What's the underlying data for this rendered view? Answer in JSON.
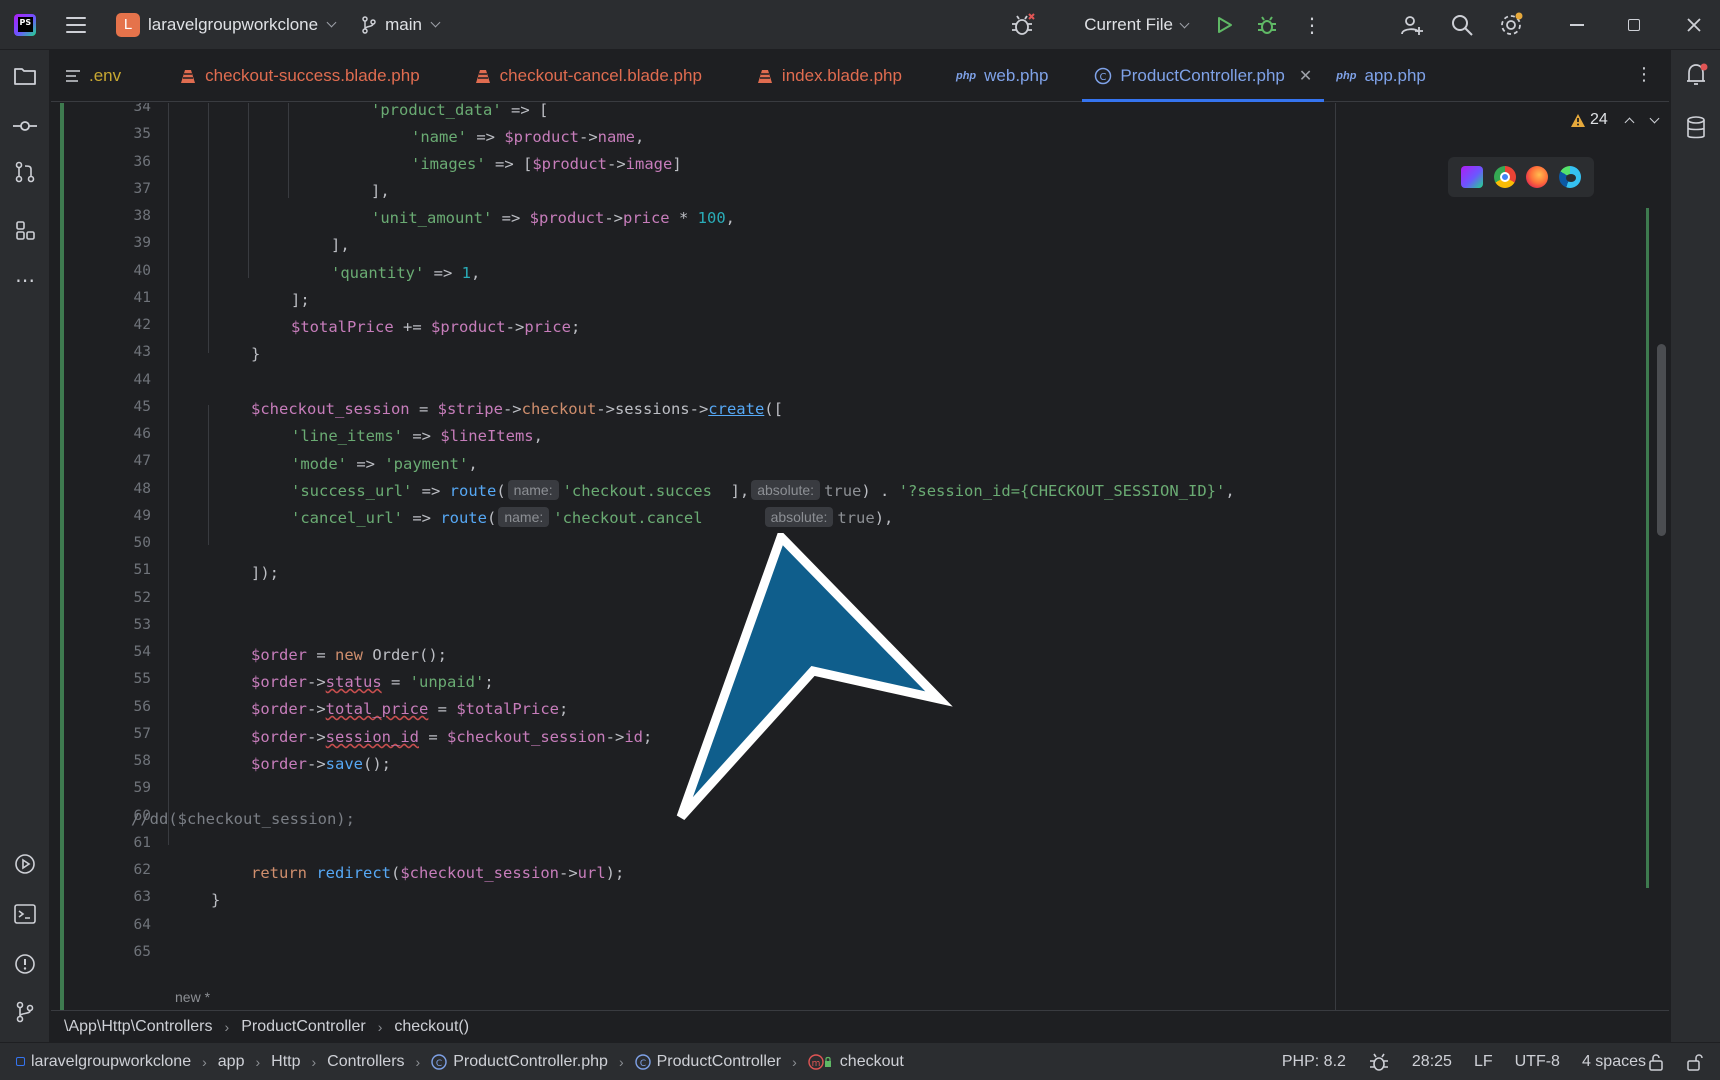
{
  "titlebar": {
    "project_badge": "L",
    "project_name": "laravelgroupworkclone",
    "branch": "main",
    "run_config": "Current File"
  },
  "tabs": [
    {
      "label": ".env",
      "kind": "env"
    },
    {
      "label": "checkout-success.blade.php",
      "kind": "blade"
    },
    {
      "label": "checkout-cancel.blade.php",
      "kind": "blade"
    },
    {
      "label": "index.blade.php",
      "kind": "blade"
    },
    {
      "label": "web.php",
      "kind": "php"
    },
    {
      "label": "ProductController.php",
      "kind": "class",
      "active": true
    },
    {
      "label": "app.php",
      "kind": "php"
    }
  ],
  "editor": {
    "warning_count": "24",
    "line_numbers": [
      "34",
      "35",
      "36",
      "37",
      "38",
      "39",
      "40",
      "41",
      "42",
      "43",
      "44",
      "45",
      "46",
      "47",
      "48",
      "49",
      "50",
      "51",
      "52",
      "53",
      "54",
      "55",
      "56",
      "57",
      "58",
      "59",
      "60",
      "61",
      "62",
      "63",
      "64",
      "65"
    ],
    "code": {
      "l34_a": "'product_data'",
      "l34_b": " => [",
      "l35_a": "'name'",
      "l35_b": " => ",
      "l35_c": "$product",
      "l35_d": "->",
      "l35_e": "name",
      "l35_f": ",",
      "l36_a": "'images'",
      "l36_b": " => [",
      "l36_c": "$product",
      "l36_d": "->",
      "l36_e": "image",
      "l36_f": "]",
      "l37": "],",
      "l38_a": "'unit_amount'",
      "l38_b": " => ",
      "l38_c": "$product",
      "l38_d": "->",
      "l38_e": "price",
      "l38_f": " * ",
      "l38_g": "100",
      "l38_h": ",",
      "l39": "],",
      "l40_a": "'quantity'",
      "l40_b": " => ",
      "l40_c": "1",
      "l40_d": ",",
      "l41": "];",
      "l42_a": "$totalPrice",
      "l42_b": " += ",
      "l42_c": "$product",
      "l42_d": "->",
      "l42_e": "price",
      "l42_f": ";",
      "l43": "}",
      "l45_a": "$checkout_session",
      "l45_b": " = ",
      "l45_c": "$stripe",
      "l45_d": "->",
      "l45_e": "checkout",
      "l45_f": "->",
      "l45_g": "sessions",
      "l45_h": "->",
      "l45_i": "create",
      "l45_j": "([",
      "l46_a": "'line_items'",
      "l46_b": " => ",
      "l46_c": "$lineItems",
      "l46_d": ",",
      "l47_a": "'mode'",
      "l47_b": " => ",
      "l47_c": "'payment'",
      "l47_d": ",",
      "l48_a": "'success_url'",
      "l48_b": " => ",
      "l48_c": "route",
      "l48_d": "(",
      "l48_hint1": "name:",
      "l48_e": "'checkout.succes",
      "l48_f": "  ],",
      "l48_hint2": "absolute:",
      "l48_g": "true",
      "l48_h": ") . ",
      "l48_i": "'?session_id={CHECKOUT_SESSION_ID}'",
      "l48_j": ",",
      "l49_a": "'cancel_url'",
      "l49_b": " => ",
      "l49_c": "route",
      "l49_d": "(",
      "l49_hint1": "name:",
      "l49_e": "'checkout.cancel",
      "l49_hint2": "absolute:",
      "l49_g": "true",
      "l49_h": "),",
      "l51": "]);",
      "l54_a": "$order",
      "l54_b": " = ",
      "l54_c": "new",
      "l54_d": " Order();",
      "l55_a": "$order",
      "l55_b": "->",
      "l55_c": "status",
      "l55_d": " = ",
      "l55_e": "'unpaid'",
      "l55_f": ";",
      "l56_a": "$order",
      "l56_b": "->",
      "l56_c": "total_price",
      "l56_d": " = ",
      "l56_e": "$totalPrice",
      "l56_f": ";",
      "l57_a": "$order",
      "l57_b": "->",
      "l57_c": "session_id",
      "l57_d": " = ",
      "l57_e": "$checkout_session",
      "l57_f": "->",
      "l57_g": "id",
      "l57_h": ";",
      "l58_a": "$order",
      "l58_b": "->",
      "l58_c": "save",
      "l58_d": "();",
      "l60": "//dd($checkout_session);",
      "l62_a": "return",
      "l62_b": " ",
      "l62_c": "redirect",
      "l62_d": "(",
      "l62_e": "$checkout_session",
      "l62_f": "->",
      "l62_g": "url",
      "l62_h": ");",
      "l63": "}"
    },
    "new_label": "new *"
  },
  "breadcrumb": [
    "\\App\\Http\\Controllers",
    "ProductController",
    "checkout()"
  ],
  "statusbar": {
    "path": [
      "laravelgroupworkclone",
      "app",
      "Http",
      "Controllers",
      "ProductController.php",
      "ProductController",
      "checkout"
    ],
    "php_version": "PHP: 8.2",
    "position": "28:25",
    "line_ending": "LF",
    "encoding": "UTF-8",
    "indent": "4 spaces"
  },
  "colors": {
    "accent": "#3574f0",
    "vcs_added": "#3e7a4f",
    "cursor_fill": "#0f5e8c"
  }
}
